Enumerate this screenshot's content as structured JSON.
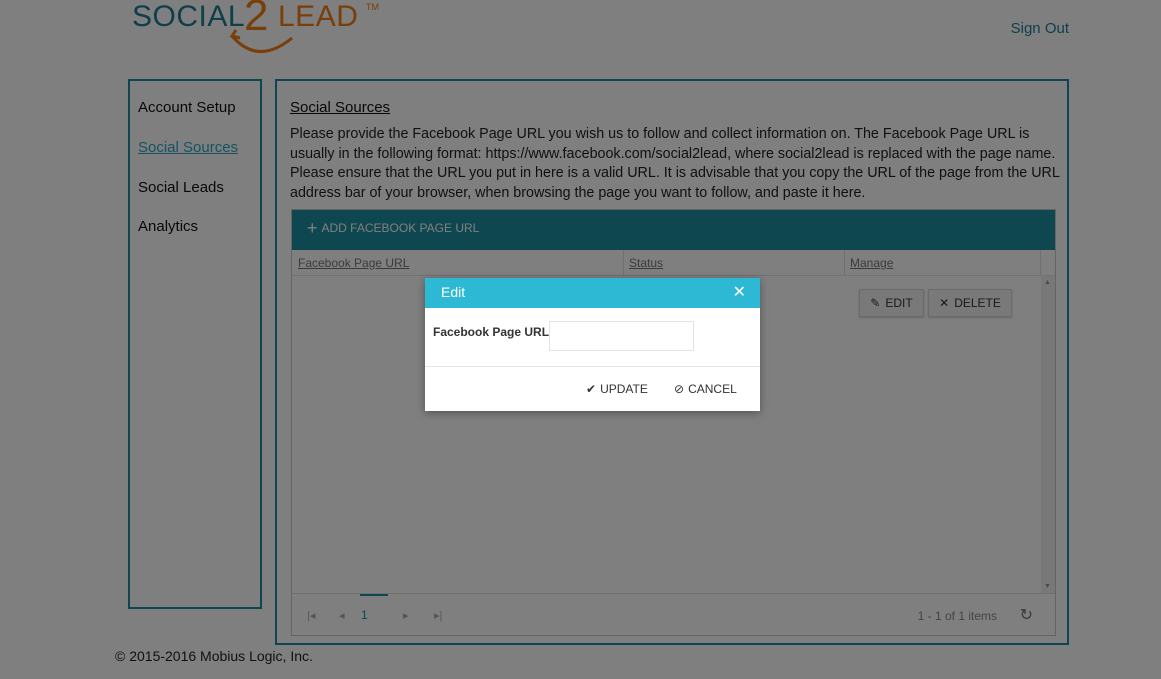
{
  "header": {
    "logo_part1": "SOCIAL",
    "logo_part2": "2",
    "logo_part3": "LEAD",
    "logo_tm": "TM",
    "sign_out": "Sign Out"
  },
  "sidebar": {
    "items": [
      {
        "label": "Account Setup",
        "active": false
      },
      {
        "label": "Social Sources",
        "active": true
      },
      {
        "label": "Social Leads",
        "active": false
      },
      {
        "label": "Analytics",
        "active": false
      }
    ]
  },
  "main": {
    "title": "Social Sources",
    "intro": "Please provide the Facebook Page URL you wish us to follow and collect information on. The Facebook Page URL is usually in the following format: https://www.facebook.com/social2lead, where social2lead is replaced with the page name. Please ensure that the URL you put in here is a valid URL. It is advisable that you copy the URL of the page from the URL address bar of your browser, when browsing the page you want to follow, and paste it here."
  },
  "grid": {
    "add_label": "ADD FACEBOOK PAGE URL",
    "columns": [
      "Facebook Page URL",
      "Status",
      "Manage"
    ],
    "edit_label": "EDIT",
    "delete_label": "DELETE",
    "current_page": "1",
    "pager_info": "1 - 1 of 1 items"
  },
  "dialog": {
    "title": "Edit",
    "field_label": "Facebook Page URL",
    "field_value": "",
    "update_label": "UPDATE",
    "cancel_label": "CANCEL"
  },
  "footer": {
    "copyright": "© 2015-2016 Mobius Logic, Inc."
  },
  "colors": {
    "brand_teal": "#1f7f97",
    "brand_orange": "#f07e16",
    "toolbar": "#1e8ea3",
    "dialog_header": "#2db9d4",
    "active_link": "#2aa6c6"
  }
}
